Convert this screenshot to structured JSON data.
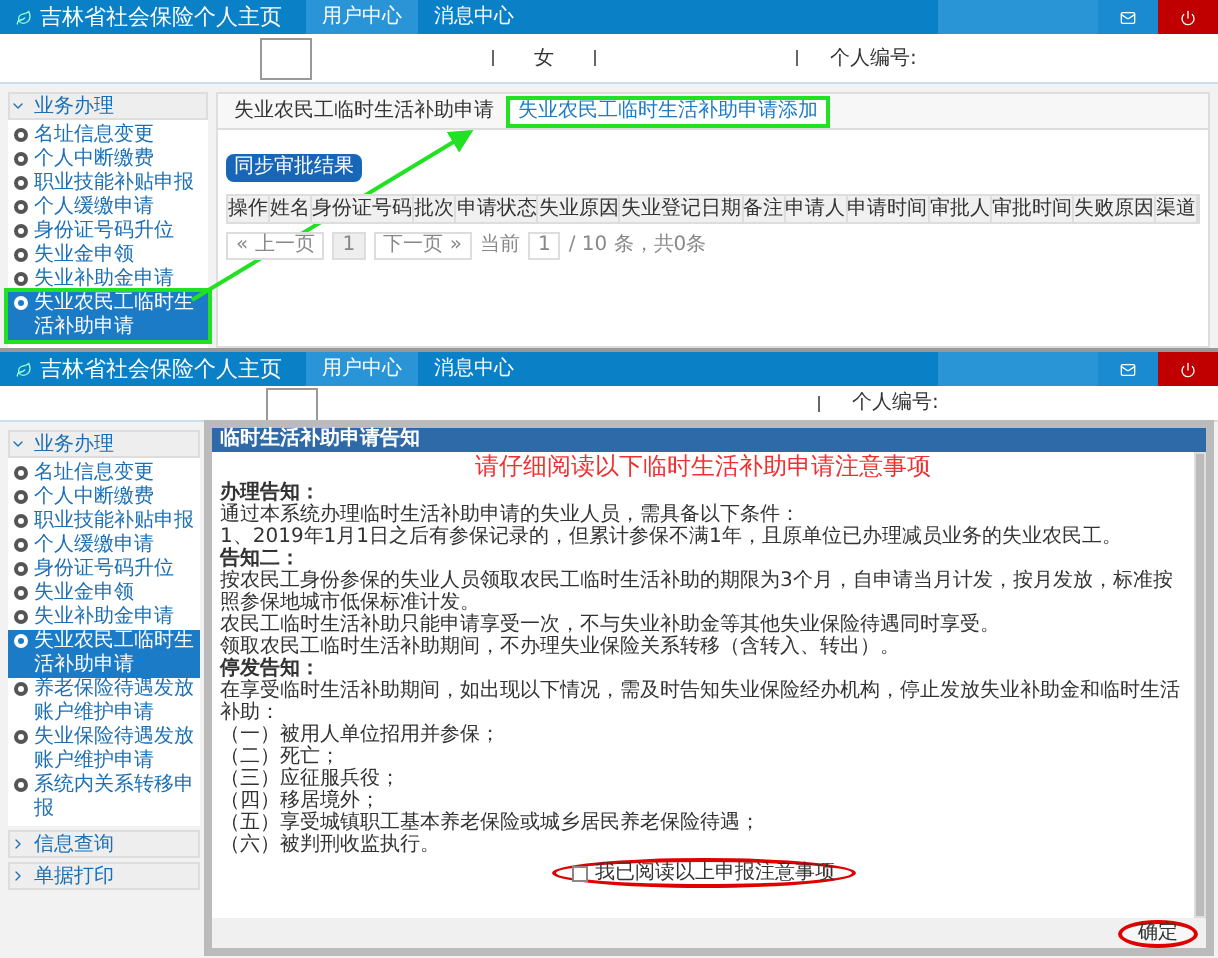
{
  "top": {
    "header": {
      "title": "吉林省社会保险个人主页",
      "nav": [
        {
          "label": "用户中心",
          "selected": true
        },
        {
          "label": "消息中心",
          "selected": false
        }
      ]
    },
    "profile": {
      "gender": "女",
      "id_label": "个人编号:"
    },
    "sidebar": {
      "heading": {
        "label": "业务办理",
        "expanded": true
      },
      "items": [
        {
          "label": "名址信息变更",
          "selected": false,
          "highlighted": false
        },
        {
          "label": "个人中断缴费",
          "selected": false,
          "highlighted": false
        },
        {
          "label": "职业技能补贴申报",
          "selected": false,
          "highlighted": false
        },
        {
          "label": "个人缓缴申请",
          "selected": false,
          "highlighted": false
        },
        {
          "label": "身份证号码升位",
          "selected": false,
          "highlighted": false
        },
        {
          "label": "失业金申领",
          "selected": false,
          "highlighted": false
        },
        {
          "label": "失业补助金申请",
          "selected": false,
          "highlighted": false
        },
        {
          "label": "失业农民工临时生活补助申请",
          "selected": true,
          "highlighted": true
        }
      ]
    },
    "tabs": [
      {
        "label": "失业农民工临时生活补助申请",
        "selected": false,
        "highlighted": false
      },
      {
        "label": "失业农民工临时生活补助申请添加",
        "selected": true,
        "highlighted": true
      }
    ],
    "sync_button": "同步审批结果",
    "table": {
      "columns": [
        "操作",
        "姓名",
        "身份证号码",
        "批次",
        "申请状态",
        "失业原因",
        "失业登记日期",
        "备注",
        "申请人",
        "申请时间",
        "审批人",
        "审批时间",
        "失败原因",
        "渠道"
      ]
    },
    "pagination": {
      "prev": "« 上一页",
      "page": "1",
      "next": "下一页 »",
      "current_label": "当前",
      "current_page": "1",
      "total": "/ 10 条，共0条"
    }
  },
  "bottom": {
    "header": {
      "title": "吉林省社会保险个人主页",
      "nav": [
        {
          "label": "用户中心",
          "selected": true
        },
        {
          "label": "消息中心",
          "selected": false
        }
      ]
    },
    "profile": {
      "id_label": "个人编号:"
    },
    "sidebar": [
      {
        "label": "业务办理",
        "expanded": true,
        "items": [
          {
            "label": "名址信息变更",
            "selected": false
          },
          {
            "label": "个人中断缴费",
            "selected": false
          },
          {
            "label": "职业技能补贴申报",
            "selected": false
          },
          {
            "label": "个人缓缴申请",
            "selected": false
          },
          {
            "label": "身份证号码升位",
            "selected": false
          },
          {
            "label": "失业金申领",
            "selected": false
          },
          {
            "label": "失业补助金申请",
            "selected": false
          },
          {
            "label": "失业农民工临时生活补助申请",
            "selected": true
          },
          {
            "label": "养老保险待遇发放账户维护申请",
            "selected": false
          },
          {
            "label": "失业保险待遇发放账户维护申请",
            "selected": false
          },
          {
            "label": "系统内关系转移申报",
            "selected": false
          }
        ]
      },
      {
        "label": "信息查询",
        "expanded": false
      },
      {
        "label": "单据打印",
        "expanded": false
      }
    ],
    "dialog": {
      "title": "临时生活补助申请告知",
      "heading": "请仔细阅读以下临时生活补助申请注意事项",
      "sections": [
        {
          "heading": "办理告知：",
          "lines": [
            "通过本系统办理临时生活补助申请的失业人员，需具备以下条件：",
            "1、2019年1月1日之后有参保记录的，但累计参保不满1年，且原单位已办理减员业务的失业农民工。"
          ]
        },
        {
          "heading": "告知二：",
          "lines": [
            "按农民工身份参保的失业人员领取农民工临时生活补助的期限为3个月，自申请当月计发，按月发放，标准按照参保地城市低保标准计发。",
            "农民工临时生活补助只能申请享受一次，不与失业补助金等其他失业保险待遇同时享受。",
            "领取农民工临时生活补助期间，不办理失业保险关系转移（含转入、转出）。"
          ]
        },
        {
          "heading": "停发告知：",
          "lines": [
            "在享受临时生活补助期间，如出现以下情况，需及时告知失业保险经办机构，停止发放失业补助金和临时生活补助：",
            "（一）被用人单位招用并参保；",
            "（二）死亡；",
            "（三）应征服兵役；",
            "（四）移居境外；",
            "（五）享受城镇职工基本养老保险或城乡居民养老保险待遇；",
            "（六）被判刑收监执行。"
          ]
        }
      ],
      "agree": {
        "label": "我已阅读以上申报注意事项",
        "checked": false,
        "circled": true
      },
      "confirm": {
        "label": "确定",
        "circled": true
      }
    }
  }
}
